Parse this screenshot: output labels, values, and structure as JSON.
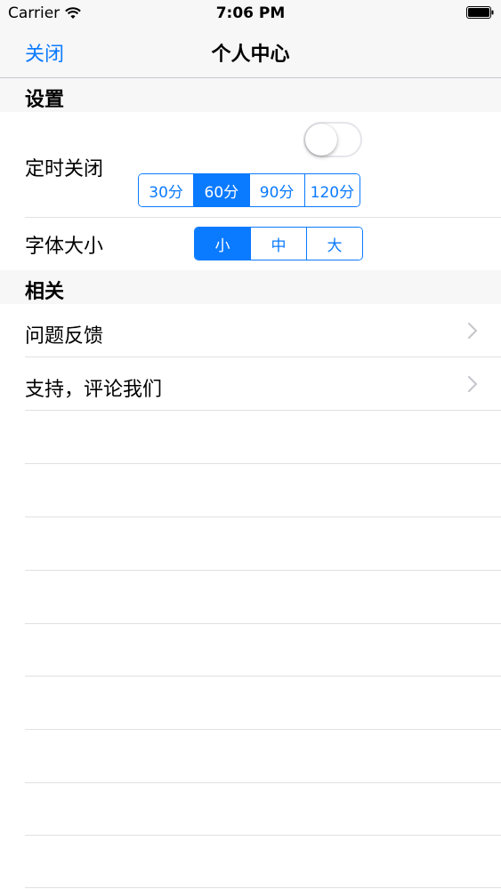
{
  "status_bar": {
    "carrier": "Carrier",
    "time": "7:06 PM",
    "icons": [
      "wifi-icon",
      "battery-icon"
    ]
  },
  "nav": {
    "close_label": "关闭",
    "title": "个人中心"
  },
  "sections": {
    "settings": {
      "header": "设置",
      "timer": {
        "label": "定时关闭",
        "toggle_on": false,
        "options": [
          "30分",
          "60分",
          "90分",
          "120分"
        ],
        "selected": "60分"
      },
      "font_size": {
        "label": "字体大小",
        "options": [
          "小",
          "中",
          "大"
        ],
        "selected": "小"
      }
    },
    "related": {
      "header": "相关",
      "items": [
        {
          "label": "问题反馈",
          "icon": "chevron-right-icon"
        },
        {
          "label": "支持，评论我们",
          "icon": "chevron-right-icon"
        }
      ]
    }
  },
  "colors": {
    "accent": "#0a7aff",
    "section_bg": "#f7f7f8",
    "separator": "#e1e1e4"
  }
}
